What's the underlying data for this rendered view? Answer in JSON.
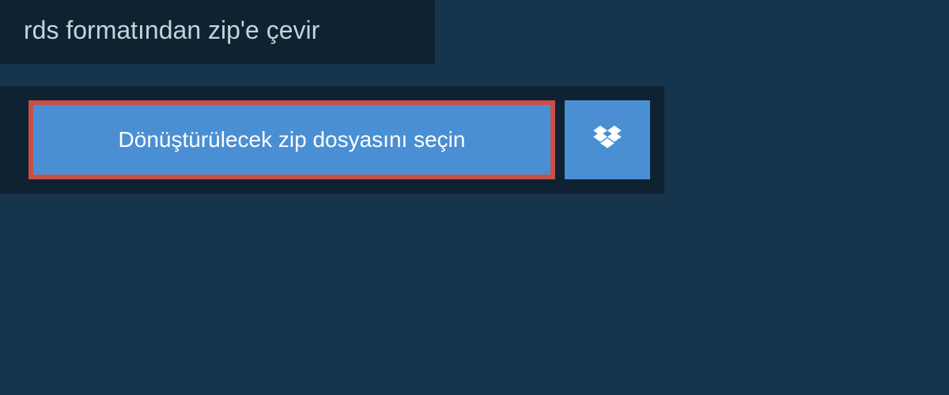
{
  "header": {
    "title": "rds formatından zip'e çevir"
  },
  "upload": {
    "select_file_label": "Dönüştürülecek zip dosyasını seçin"
  },
  "colors": {
    "background_outer": "#16344b",
    "background_inner": "#0f2231",
    "button_blue": "#4a8fd3",
    "border_red": "#c84f4a"
  }
}
